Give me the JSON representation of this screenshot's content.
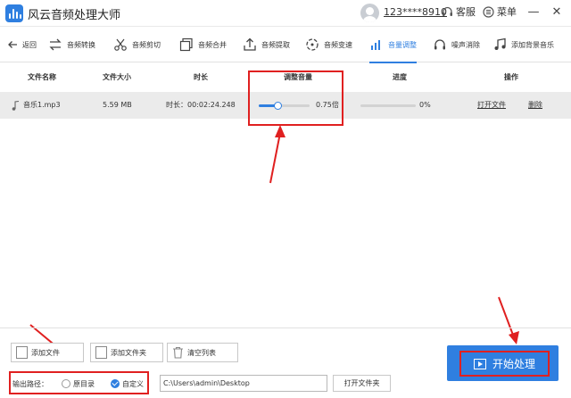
{
  "app": {
    "title": "风云音频处理大师",
    "user_id": "123****8910",
    "service_label": "客服",
    "menu_label": "菜单",
    "minimize": "—",
    "close": "✕"
  },
  "toolbar": {
    "back": "返回",
    "items": [
      {
        "label": "音频转换",
        "icon": "convert-icon"
      },
      {
        "label": "音频剪切",
        "icon": "scissors-icon"
      },
      {
        "label": "音频合并",
        "icon": "merge-icon"
      },
      {
        "label": "音频提取",
        "icon": "extract-icon"
      },
      {
        "label": "音频变速",
        "icon": "speed-icon"
      },
      {
        "label": "音量调整",
        "icon": "volume-icon",
        "active": true
      },
      {
        "label": "噪声消除",
        "icon": "noise-icon"
      },
      {
        "label": "添加背景音乐",
        "icon": "music-icon"
      }
    ]
  },
  "table": {
    "headers": {
      "name": "文件名称",
      "size": "文件大小",
      "duration": "时长",
      "volume": "调整音量",
      "progress": "进度",
      "actions": "操作"
    },
    "rows": [
      {
        "name": "音乐1.mp3",
        "size": "5.59 MB",
        "duration": "时长：00:02:24.248",
        "volume_value": 0.75,
        "volume_label": "0.75倍",
        "progress_value": 0,
        "progress_label": "0%",
        "open_folder": "打开文件",
        "delete": "删除"
      }
    ]
  },
  "bottom": {
    "add_file": "添加文件",
    "add_folder": "添加文件夹",
    "clear_list": "清空列表",
    "output_label": "输出路径：",
    "option_original": "原目录",
    "option_custom": "自定义",
    "selected": "custom",
    "path_value": "C:\\Users\\admin\\Desktop",
    "open_folder": "打开文件夹",
    "start": "开始处理"
  },
  "colors": {
    "accent": "#2f7fe0",
    "annotation": "#e02020",
    "row_bg": "#ebebeb"
  }
}
